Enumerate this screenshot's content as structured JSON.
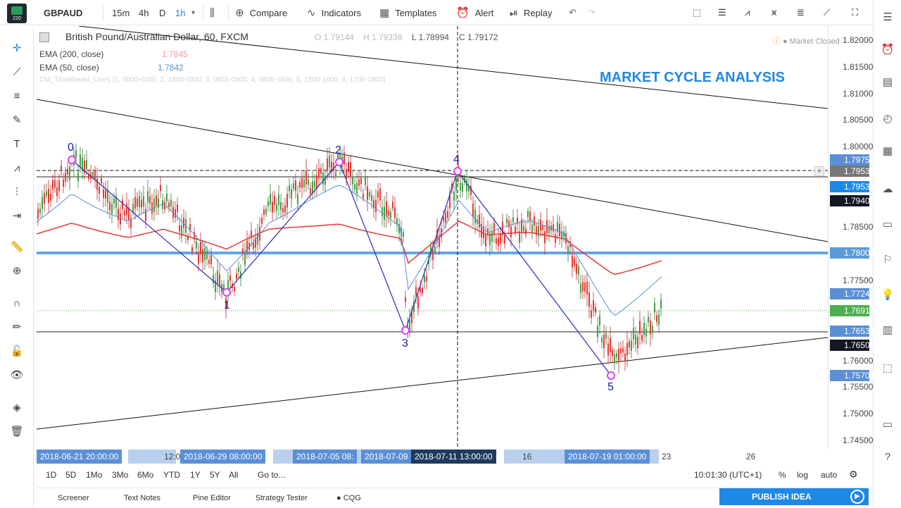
{
  "header": {
    "symbol": "GBPAUD",
    "intervals": [
      "15m",
      "4h",
      "D",
      "1h"
    ],
    "compare": "Compare",
    "indicators": "Indicators",
    "templates": "Templates",
    "alert": "Alert",
    "replay": "Replay"
  },
  "legend": {
    "title": "British Pound/Australian Dollar, 60, FXCM",
    "ohlc_o": "O 1.79144",
    "ohlc_h": "H 1.79338",
    "ohlc_l": "L 1.78994",
    "ohlc_c": "C 1.79172",
    "ema200": "EMA (200, close)",
    "ema200_val": "1.7845",
    "ema50": "EMA (50, close)",
    "ema50_val": "1.7842",
    "timelines": "CM_TimeBased_Lines (1, 0000-0100, 2, 1800-0300, 3, 0801-0900, 4, 0800-1600, 5, 1500-1600, 6, 1700-1800)",
    "market_status": "Market Closed"
  },
  "annotation": "MARKET CYCLE ANALYSIS",
  "waves": [
    "0",
    "2",
    "1",
    "3",
    "4",
    "5"
  ],
  "price_ticks": [
    "1.82000",
    "1.81500",
    "1.81000",
    "1.80500",
    "1.80000",
    "1.78500",
    "1.77500",
    "1.76000",
    "1.75500",
    "1.75000",
    "1.74500"
  ],
  "price_labels": [
    {
      "text": "1.79756",
      "color": "#5b8fd6"
    },
    {
      "text": "1.79533",
      "color": "#777777"
    },
    {
      "text": "1.79533",
      "color": "#1e88e5"
    },
    {
      "text": "1.79400",
      "color": "#131722"
    },
    {
      "text": "1.78000",
      "color": "#5b9bd5"
    },
    {
      "text": "1.77241",
      "color": "#5b8fd6"
    },
    {
      "text": "1.76918",
      "color": "#4caf50"
    },
    {
      "text": "1.76534",
      "color": "#5b8fd6"
    },
    {
      "text": "1.76500",
      "color": "#131722"
    },
    {
      "text": "1.75704",
      "color": "#5b8fd6"
    }
  ],
  "time_labels": {
    "l1": "2018-06-21 20:00:00",
    "l2": "12:0",
    "l3": "2018-06-29 08:00:00",
    "l4": "2018-07-05 08:",
    "l5": "2018-07-09",
    "l6": "2018-07-11 13:00:00",
    "l7": "16",
    "l8": "2018-07-19 01:00:00",
    "l9": "23",
    "l10": "26"
  },
  "range": {
    "buttons": [
      "1D",
      "5D",
      "1Mo",
      "3Mo",
      "6Mo",
      "YTD",
      "1Y",
      "5Y",
      "All"
    ],
    "goto": "Go to...",
    "clock": "10:01:30 (UTC+1)",
    "pct": "%",
    "log": "log",
    "auto": "auto"
  },
  "bottom": {
    "tabs": [
      "Screener",
      "Text Notes",
      "Pine Editor",
      "Strategy Tester",
      "CQG"
    ],
    "publish": "PUBLISH IDEA"
  },
  "colors": {
    "accent": "#1e88e5",
    "wave": "#1a1aa0",
    "ema200": "#e53935",
    "ema50": "#5b8fd6"
  }
}
